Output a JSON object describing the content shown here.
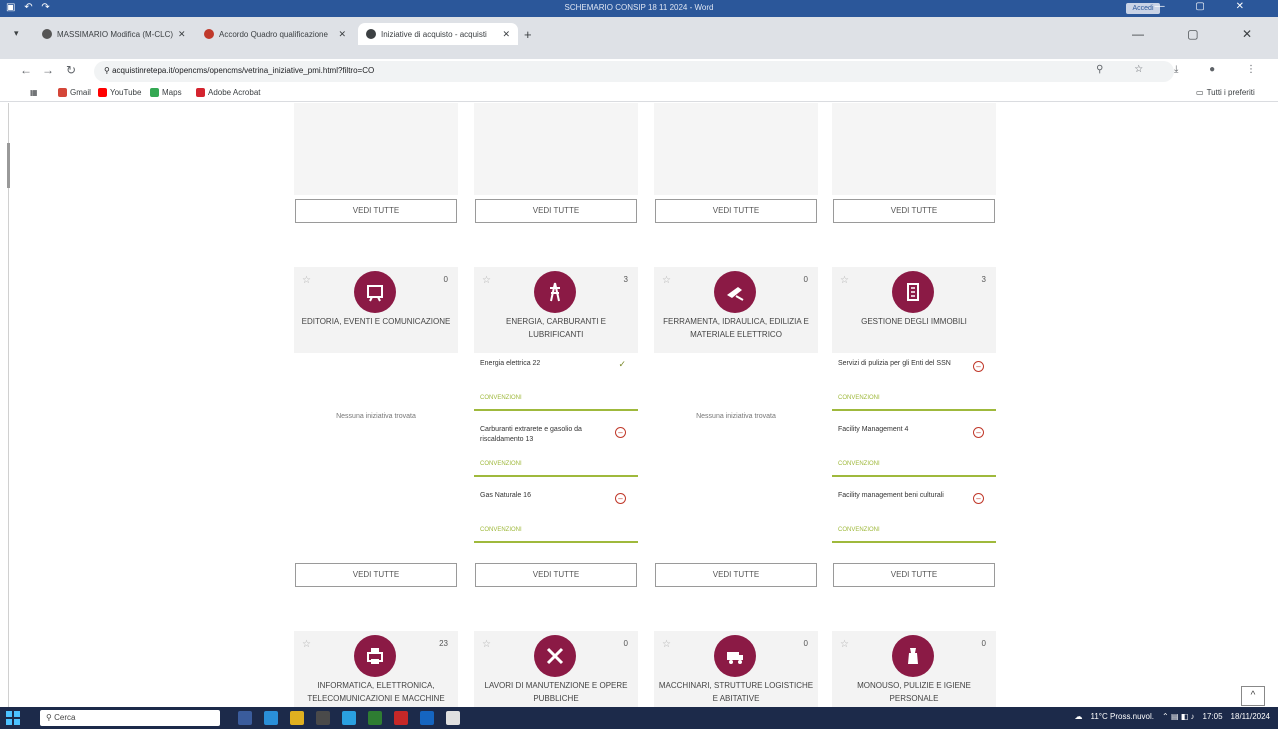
{
  "word": {
    "title": "SCHEMARIO CONSIP 18 11 2024 - Word",
    "account": "Accedi"
  },
  "tabs": [
    {
      "label": "MASSIMARIO Modifica (M-CLC)",
      "color": "#555"
    },
    {
      "label": "Accordo Quadro qualificazione",
      "color": "#c0392b"
    },
    {
      "label": "Iniziative di acquisto - acquisti",
      "color": "#3c4043"
    }
  ],
  "address": {
    "url": "acquistinretepa.it/opencms/opencms/vetrina_iniziative_pmi.html?filtro=CO"
  },
  "bookmarks": [
    {
      "label": "Gmail",
      "color": "#d44638"
    },
    {
      "label": "YouTube",
      "color": "#ff0000"
    },
    {
      "label": "Maps",
      "color": "#34a853"
    },
    {
      "label": "Adobe Acrobat",
      "color": "#d4242f"
    }
  ],
  "bookmarks_right": "Tutti i preferiti",
  "vedi_label": "VEDI TUTTE",
  "empty_label": "Nessuna iniziativa trovata",
  "categories_row1": [
    {
      "title": "EDITORIA, EVENTI E COMUNICAZIONE",
      "count": "0",
      "icon": "book-icon",
      "items": []
    },
    {
      "title": "ENERGIA, CARBURANTI E LUBRIFICANTI",
      "count": "3",
      "icon": "pylon-icon",
      "items": [
        {
          "name": "Energia elettrica 22",
          "sub": "CONVENZIONI",
          "status": "check"
        },
        {
          "name": "Carburanti extrarete e gasolio da riscaldamento 13",
          "sub": "CONVENZIONI",
          "status": "circle"
        },
        {
          "name": "Gas Naturale 16",
          "sub": "CONVENZIONI",
          "status": "circle"
        }
      ]
    },
    {
      "title": "FERRAMENTA, IDRAULICA, EDILIZIA E MATERIALE ELETTRICO",
      "count": "0",
      "icon": "tools-icon",
      "items": []
    },
    {
      "title": "GESTIONE DEGLI IMMOBILI",
      "count": "3",
      "icon": "building-icon",
      "items": [
        {
          "name": "Servizi di pulizia per gli Enti del SSN",
          "sub": "CONVENZIONI",
          "status": "circle"
        },
        {
          "name": "Facility Management 4",
          "sub": "CONVENZIONI",
          "status": "circle"
        },
        {
          "name": "Facility management beni culturali",
          "sub": "CONVENZIONI",
          "status": "circle"
        }
      ]
    }
  ],
  "categories_row2": [
    {
      "title": "INFORMATICA, ELETTRONICA, TELECOMUNICAZIONI E MACCHINE",
      "count": "23",
      "icon": "printer-icon"
    },
    {
      "title": "LAVORI DI MANUTENZIONE E OPERE PUBBLICHE",
      "count": "0",
      "icon": "wrench-icon"
    },
    {
      "title": "MACCHINARI, STRUTTURE LOGISTICHE E ABITATIVE",
      "count": "0",
      "icon": "truck-icon"
    },
    {
      "title": "MONOUSO, PULIZIE E IGIENE PERSONALE",
      "count": "0",
      "icon": "cleaning-icon"
    }
  ],
  "taskbar": {
    "search": "Cerca",
    "weather": "11°C Pross.nuvol.",
    "time": "17:05",
    "date": "18/11/2024"
  }
}
